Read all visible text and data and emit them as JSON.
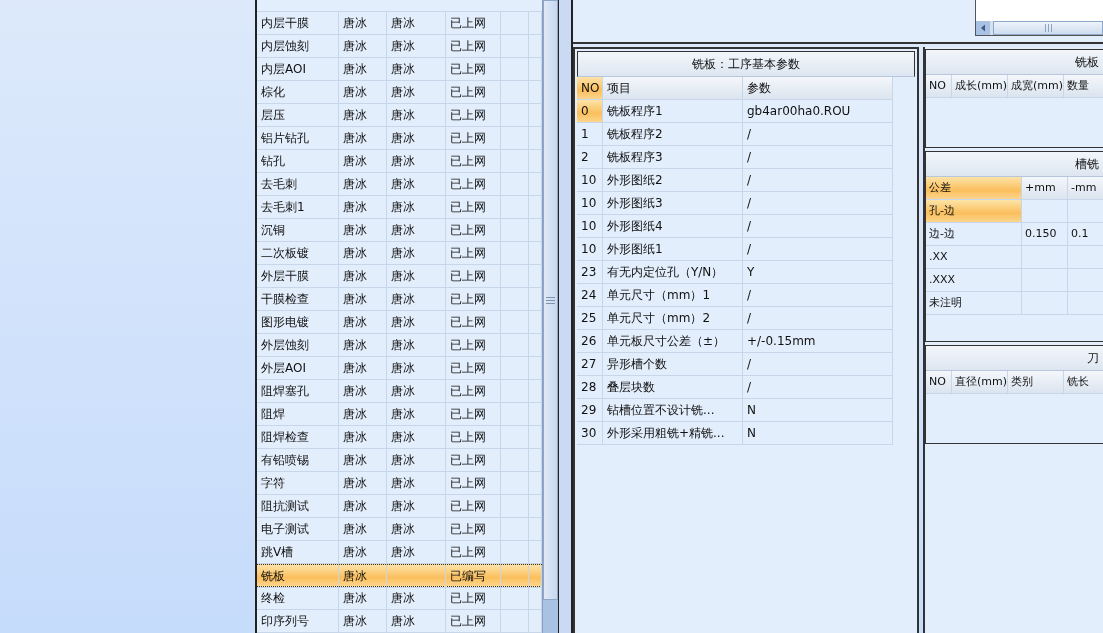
{
  "process_list": {
    "rows": [
      {
        "column_1": "内层干膜",
        "column_2": "唐冰",
        "column_3": "唐冰",
        "column_4": "已上网",
        "selected": false
      },
      {
        "column_1": "内层蚀刻",
        "column_2": "唐冰",
        "column_3": "唐冰",
        "column_4": "已上网",
        "selected": false
      },
      {
        "column_1": "内层AOI",
        "column_2": "唐冰",
        "column_3": "唐冰",
        "column_4": "已上网",
        "selected": false
      },
      {
        "column_1": "棕化",
        "column_2": "唐冰",
        "column_3": "唐冰",
        "column_4": "已上网",
        "selected": false
      },
      {
        "column_1": "层压",
        "column_2": "唐冰",
        "column_3": "唐冰",
        "column_4": "已上网",
        "selected": false
      },
      {
        "column_1": "铝片钻孔",
        "column_2": "唐冰",
        "column_3": "唐冰",
        "column_4": "已上网",
        "selected": false
      },
      {
        "column_1": "钻孔",
        "column_2": "唐冰",
        "column_3": "唐冰",
        "column_4": "已上网",
        "selected": false
      },
      {
        "column_1": "去毛刺",
        "column_2": "唐冰",
        "column_3": "唐冰",
        "column_4": "已上网",
        "selected": false
      },
      {
        "column_1": "去毛刺1",
        "column_2": "唐冰",
        "column_3": "唐冰",
        "column_4": "已上网",
        "selected": false
      },
      {
        "column_1": "沉铜",
        "column_2": "唐冰",
        "column_3": "唐冰",
        "column_4": "已上网",
        "selected": false
      },
      {
        "column_1": "二次板镀",
        "column_2": "唐冰",
        "column_3": "唐冰",
        "column_4": "已上网",
        "selected": false
      },
      {
        "column_1": "外层干膜",
        "column_2": "唐冰",
        "column_3": "唐冰",
        "column_4": "已上网",
        "selected": false
      },
      {
        "column_1": "干膜检查",
        "column_2": "唐冰",
        "column_3": "唐冰",
        "column_4": "已上网",
        "selected": false
      },
      {
        "column_1": "图形电镀",
        "column_2": "唐冰",
        "column_3": "唐冰",
        "column_4": "已上网",
        "selected": false
      },
      {
        "column_1": "外层蚀刻",
        "column_2": "唐冰",
        "column_3": "唐冰",
        "column_4": "已上网",
        "selected": false
      },
      {
        "column_1": "外层AOI",
        "column_2": "唐冰",
        "column_3": "唐冰",
        "column_4": "已上网",
        "selected": false
      },
      {
        "column_1": "阻焊塞孔",
        "column_2": "唐冰",
        "column_3": "唐冰",
        "column_4": "已上网",
        "selected": false
      },
      {
        "column_1": "阻焊",
        "column_2": "唐冰",
        "column_3": "唐冰",
        "column_4": "已上网",
        "selected": false
      },
      {
        "column_1": "阻焊检查",
        "column_2": "唐冰",
        "column_3": "唐冰",
        "column_4": "已上网",
        "selected": false
      },
      {
        "column_1": "有铅喷锡",
        "column_2": "唐冰",
        "column_3": "唐冰",
        "column_4": "已上网",
        "selected": false
      },
      {
        "column_1": "字符",
        "column_2": "唐冰",
        "column_3": "唐冰",
        "column_4": "已上网",
        "selected": false
      },
      {
        "column_1": "阻抗测试",
        "column_2": "唐冰",
        "column_3": "唐冰",
        "column_4": "已上网",
        "selected": false
      },
      {
        "column_1": "电子测试",
        "column_2": "唐冰",
        "column_3": "唐冰",
        "column_4": "已上网",
        "selected": false
      },
      {
        "column_1": "跳V槽",
        "column_2": "唐冰",
        "column_3": "唐冰",
        "column_4": "已上网",
        "selected": false
      },
      {
        "column_1": "铣板",
        "column_2": "唐冰",
        "column_4": "已编写",
        "selected": true
      },
      {
        "column_1": "终检",
        "column_2": "唐冰",
        "column_3": "唐冰",
        "column_4": "已上网",
        "selected": false
      },
      {
        "column_1": "印序列号",
        "column_2": "唐冰",
        "column_3": "唐冰",
        "column_4": "已上网",
        "selected": false
      }
    ]
  },
  "parameters": {
    "title": "铣板：工序基本参数",
    "columns": [
      "NO",
      "项目",
      "参数"
    ],
    "rows": [
      {
        "no": "0",
        "item": "铣板程序1",
        "value": "gb4ar00ha0.ROU",
        "selected": true
      },
      {
        "no": "1",
        "item": "铣板程序2",
        "value": "/",
        "selected": false
      },
      {
        "no": "2",
        "item": "铣板程序3",
        "value": "/",
        "selected": false
      },
      {
        "no": "10",
        "item": "外形图纸2",
        "value": "/",
        "selected": false
      },
      {
        "no": "10",
        "item": "外形图纸3",
        "value": "/",
        "selected": false
      },
      {
        "no": "10",
        "item": "外形图纸4",
        "value": "/",
        "selected": false
      },
      {
        "no": "10",
        "item": "外形图纸1",
        "value": "/",
        "selected": false
      },
      {
        "no": "23",
        "item": "有无内定位孔（Y/N）",
        "value": "Y",
        "selected": false
      },
      {
        "no": "24",
        "item": "单元尺寸（mm）1",
        "value": "/",
        "selected": false
      },
      {
        "no": "25",
        "item": "单元尺寸（mm）2",
        "value": "/",
        "selected": false
      },
      {
        "no": "26",
        "item": "单元板尺寸公差（±）",
        "value": "+/-0.15mm",
        "selected": false
      },
      {
        "no": "27",
        "item": "异形槽个数",
        "value": "/",
        "selected": false
      },
      {
        "no": "28",
        "item": "叠层块数",
        "value": "/",
        "selected": false
      },
      {
        "no": "29",
        "item": "钻槽位置不设计铣...",
        "value": "N",
        "selected": false
      },
      {
        "no": "30",
        "item": "外形采用粗铣+精铣...",
        "value": "N",
        "selected": false
      }
    ]
  },
  "side_sections": [
    {
      "title": "铣板",
      "columns": [
        "NO",
        "成长(mm)",
        "成宽(mm)",
        "数量"
      ]
    },
    {
      "title": "槽铣",
      "columns": [
        "公差",
        "+mm",
        "-mm"
      ],
      "rows": [
        {
          "cells": [
            "孔-边",
            null,
            null
          ],
          "selected": true
        },
        {
          "cells": [
            "边-边",
            "0.150",
            "0.1"
          ],
          "selected": false
        },
        {
          "cells": [
            ".XX",
            null,
            null
          ],
          "selected": false
        },
        {
          "cells": [
            ".XXX",
            null,
            null
          ],
          "selected": false
        },
        {
          "cells": [
            "未注明",
            null,
            null
          ],
          "selected": false
        }
      ]
    },
    {
      "title": "刀",
      "columns": [
        "NO",
        "直径(mm)",
        "类别",
        "铣长"
      ]
    }
  ]
}
